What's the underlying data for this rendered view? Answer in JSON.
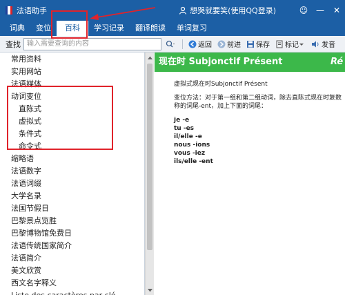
{
  "window": {
    "title": "法语助手",
    "user_label": "想哭就要笑(使用QQ登录)"
  },
  "menu": {
    "items": [
      "词典",
      "变位",
      "百科",
      "学习记录",
      "翻译朗读",
      "单词复习"
    ],
    "active": "百科"
  },
  "search": {
    "label": "查找",
    "placeholder": "输入需要查询的内容"
  },
  "toolbar": {
    "back": "返回",
    "forward": "前进",
    "save": "保存",
    "bookmark": "标记",
    "speak": "发音"
  },
  "sidebar": {
    "items": [
      {
        "label": "常用资料",
        "sub": false
      },
      {
        "label": "实用网站",
        "sub": false
      },
      {
        "label": "法语媒体",
        "sub": false
      },
      {
        "label": "动词变位",
        "sub": false
      },
      {
        "label": "直陈式",
        "sub": true
      },
      {
        "label": "虚拟式",
        "sub": true
      },
      {
        "label": "条件式",
        "sub": true
      },
      {
        "label": "命令式",
        "sub": true
      },
      {
        "label": "缩略语",
        "sub": false
      },
      {
        "label": "法语数字",
        "sub": false
      },
      {
        "label": "法语词缀",
        "sub": false
      },
      {
        "label": "大学名录",
        "sub": false
      },
      {
        "label": "法国节假日",
        "sub": false
      },
      {
        "label": "巴黎景点览胜",
        "sub": false
      },
      {
        "label": "巴黎博物馆免费日",
        "sub": false
      },
      {
        "label": "法语传统国家简介",
        "sub": false
      },
      {
        "label": "法语简介",
        "sub": false
      },
      {
        "label": "美文欣赏",
        "sub": false
      },
      {
        "label": "西文名字释义",
        "sub": false
      },
      {
        "label": "Liste des caractères par clé",
        "sub": false
      }
    ]
  },
  "content": {
    "header_title": "现在时 Subjonctif Présent",
    "header_overflow": "Ré",
    "intro": "虚拟式现在时Subjonctif Présent",
    "method_line1": "变位方法：对于第一组和第二组动词，除去直陈式现在时复数",
    "method_line2": "称的词尾-ent，加上下面的词尾：",
    "conjugations": [
      "je -e",
      "tu -es",
      "il/elle -e",
      "nous -ions",
      "vous -iez",
      "ils/elle -ent"
    ]
  },
  "colors": {
    "titlebar": "#1c5fa5",
    "header_green": "#3cb84a",
    "annotation_red": "#e0232b"
  }
}
